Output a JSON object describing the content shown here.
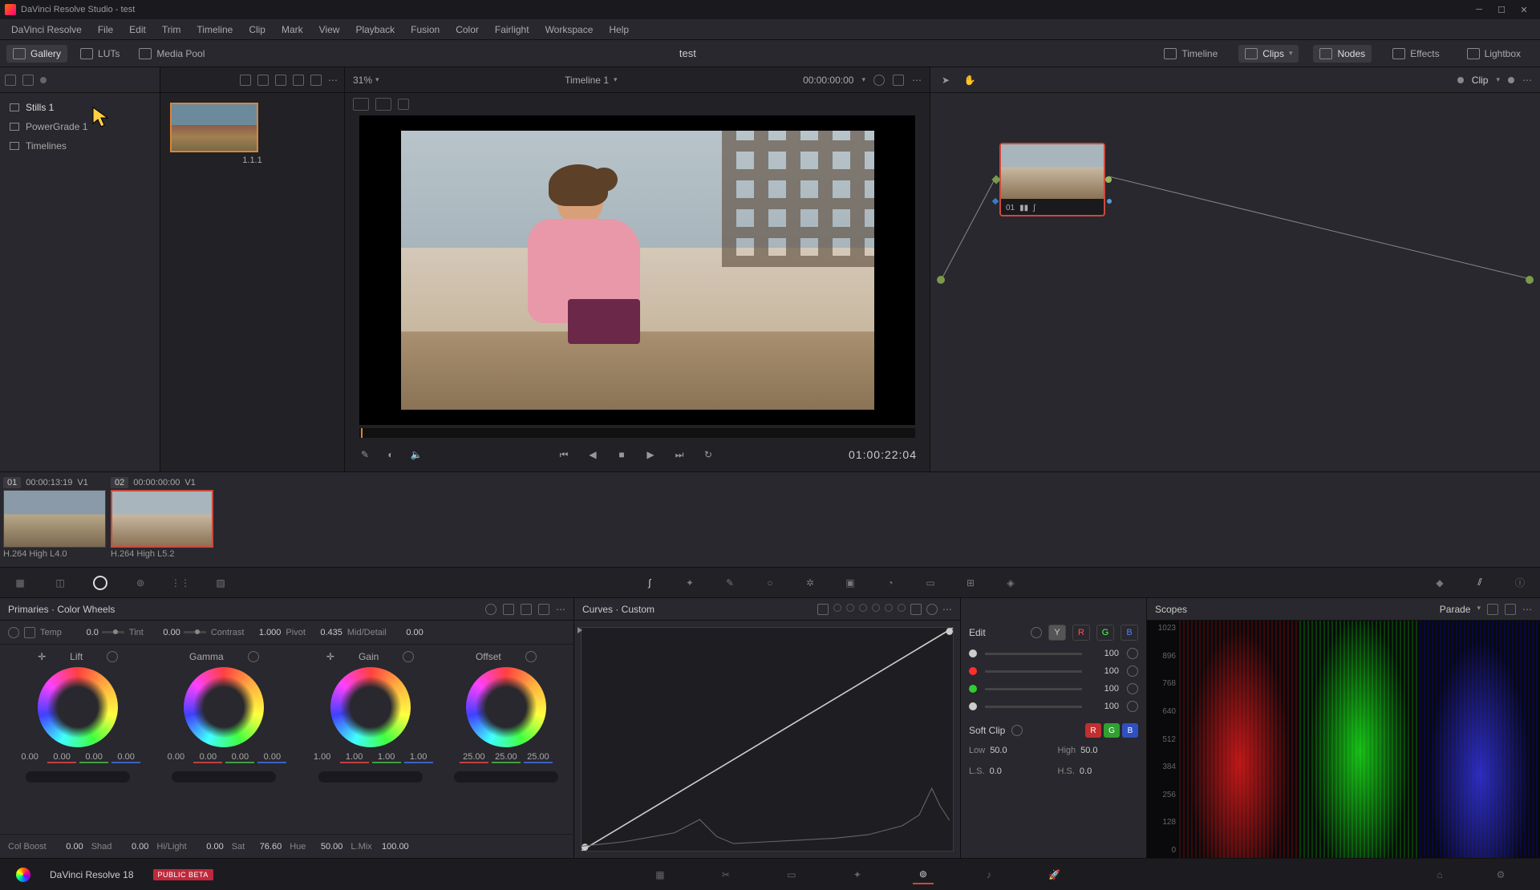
{
  "window": {
    "title": "DaVinci Resolve Studio - test",
    "project_name": "test"
  },
  "menu": [
    "DaVinci Resolve",
    "File",
    "Edit",
    "Trim",
    "Timeline",
    "Clip",
    "Mark",
    "View",
    "Playback",
    "Fusion",
    "Color",
    "Fairlight",
    "Workspace",
    "Help"
  ],
  "sec_toolbar": {
    "gallery": "Gallery",
    "luts": "LUTs",
    "media_pool": "Media Pool",
    "timeline": "Timeline",
    "clips": "Clips",
    "nodes": "Nodes",
    "effects": "Effects",
    "lightbox": "Lightbox"
  },
  "gallery": {
    "items": [
      "Stills 1",
      "PowerGrade 1",
      "Timelines"
    ],
    "still_label": "1.1.1"
  },
  "viewer": {
    "zoom": "31%",
    "timeline_name": "Timeline 1",
    "timecode_in": "00:00:00:00",
    "timecode_current": "01:00:22:04"
  },
  "nodes": {
    "dropdown_label": "Clip",
    "node_number": "01"
  },
  "clips": [
    {
      "num": "01",
      "tc": "00:00:13:19",
      "track": "V1",
      "codec": "H.264 High L4.0",
      "selected": false
    },
    {
      "num": "02",
      "tc": "00:00:00:00",
      "track": "V1",
      "codec": "H.264 High L5.2",
      "selected": true
    }
  ],
  "primaries": {
    "title": "Primaries · Color Wheels",
    "temp_label": "Temp",
    "temp": "0.0",
    "tint_label": "Tint",
    "tint": "0.00",
    "contrast_label": "Contrast",
    "contrast": "1.000",
    "pivot_label": "Pivot",
    "pivot": "0.435",
    "middetail_label": "Mid/Detail",
    "middetail": "0.00",
    "wheels": [
      {
        "name": "Lift",
        "vals": [
          "0.00",
          "0.00",
          "0.00",
          "0.00"
        ]
      },
      {
        "name": "Gamma",
        "vals": [
          "0.00",
          "0.00",
          "0.00",
          "0.00"
        ]
      },
      {
        "name": "Gain",
        "vals": [
          "1.00",
          "1.00",
          "1.00",
          "1.00"
        ]
      },
      {
        "name": "Offset",
        "vals": [
          "25.00",
          "25.00",
          "25.00"
        ]
      }
    ],
    "colboost_label": "Col Boost",
    "colboost": "0.00",
    "shad_label": "Shad",
    "shad": "0.00",
    "hilight_label": "Hi/Light",
    "hilight": "0.00",
    "sat_label": "Sat",
    "sat": "76.60",
    "hue_label": "Hue",
    "hue": "50.00",
    "lmix_label": "L.Mix",
    "lmix": "100.00"
  },
  "curves": {
    "title": "Curves · Custom",
    "edit_label": "Edit",
    "channels": [
      "Y",
      "R",
      "G",
      "B"
    ],
    "intensities": [
      "100",
      "100",
      "100",
      "100"
    ],
    "softclip_label": "Soft Clip",
    "low_label": "Low",
    "low": "50.0",
    "high_label": "High",
    "high": "50.0",
    "ls_label": "L.S.",
    "ls": "0.0",
    "hs_label": "H.S.",
    "hs": "0.0"
  },
  "scopes": {
    "title": "Scopes",
    "mode": "Parade",
    "scale": [
      "1023",
      "896",
      "768",
      "640",
      "512",
      "384",
      "256",
      "128",
      "0"
    ]
  },
  "footer": {
    "version": "DaVinci Resolve 18",
    "beta": "PUBLIC BETA"
  }
}
